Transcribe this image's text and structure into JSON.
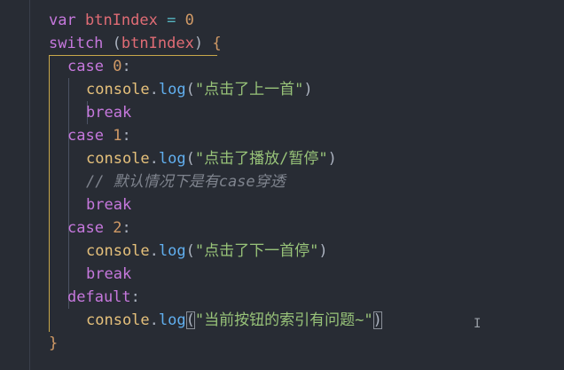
{
  "code": {
    "l1": {
      "kw": "var",
      "name": "btnIndex",
      "op": "=",
      "num": "0"
    },
    "l2": {
      "kw": "switch",
      "open": "(",
      "arg": "btnIndex",
      "close": ")",
      "brace": "{"
    },
    "l3": {
      "kw": "case",
      "num": "0",
      "colon": ":"
    },
    "l4": {
      "obj": "console",
      "dot": ".",
      "fn": "log",
      "open": "(",
      "str": "\"点击了上一首\"",
      "close": ")"
    },
    "l5": {
      "kw": "break"
    },
    "l6": {
      "kw": "case",
      "num": "1",
      "colon": ":"
    },
    "l7": {
      "obj": "console",
      "dot": ".",
      "fn": "log",
      "open": "(",
      "str": "\"点击了播放/暂停\"",
      "close": ")"
    },
    "l8": {
      "comment": "// 默认情况下是有case穿透"
    },
    "l9": {
      "kw": "break"
    },
    "l10": {
      "kw": "case",
      "num": "2",
      "colon": ":"
    },
    "l11": {
      "obj": "console",
      "dot": ".",
      "fn": "log",
      "open": "(",
      "str": "\"点击了下一首停\"",
      "close": ")"
    },
    "l12": {
      "kw": "break"
    },
    "l13": {
      "kw": "default",
      "colon": ":"
    },
    "l14": {
      "obj": "console",
      "dot": ".",
      "fn": "log",
      "open": "(",
      "str": "\"当前按钮的索引有问题~\"",
      "close": ")"
    },
    "l15": {
      "brace": "}"
    }
  },
  "cursor_glyph": "I"
}
